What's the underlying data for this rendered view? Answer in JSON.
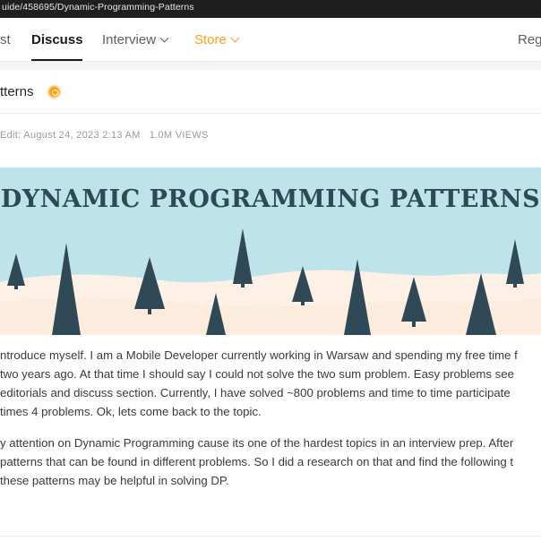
{
  "browser": {
    "url": "uide/458695/Dynamic-Programming-Patterns"
  },
  "nav": {
    "items": [
      {
        "label": "st"
      },
      {
        "label": "Discuss"
      },
      {
        "label": "Interview"
      },
      {
        "label": "Store"
      },
      {
        "label": "Regi"
      }
    ],
    "store_color": "#ffa116"
  },
  "post": {
    "title": "tterns",
    "meta_edit": "Edit: August 24, 2023 2:13 AM",
    "meta_views": "1.0M VIEWS",
    "banner_title": "DYNAMIC PROGRAMMING PATTERNS",
    "paragraph1": [
      "ntroduce myself. I am a Mobile Developer currently working in Warsaw and spending my free time f",
      " two years ago. At that time I should say I could not solve the two sum problem. Easy problems see",
      "editorials and discuss section. Currently, I have solved ~800 problems and time to time participate",
      "times 4 problems. Ok, lets come back to the topic."
    ],
    "paragraph2": [
      "y attention on Dynamic Programming cause its one of the hardest topics in an interview prep. After",
      "patterns that can be found in different problems. So I did a research on that and find the following t",
      "these patterns may be helpful in solving DP."
    ]
  }
}
